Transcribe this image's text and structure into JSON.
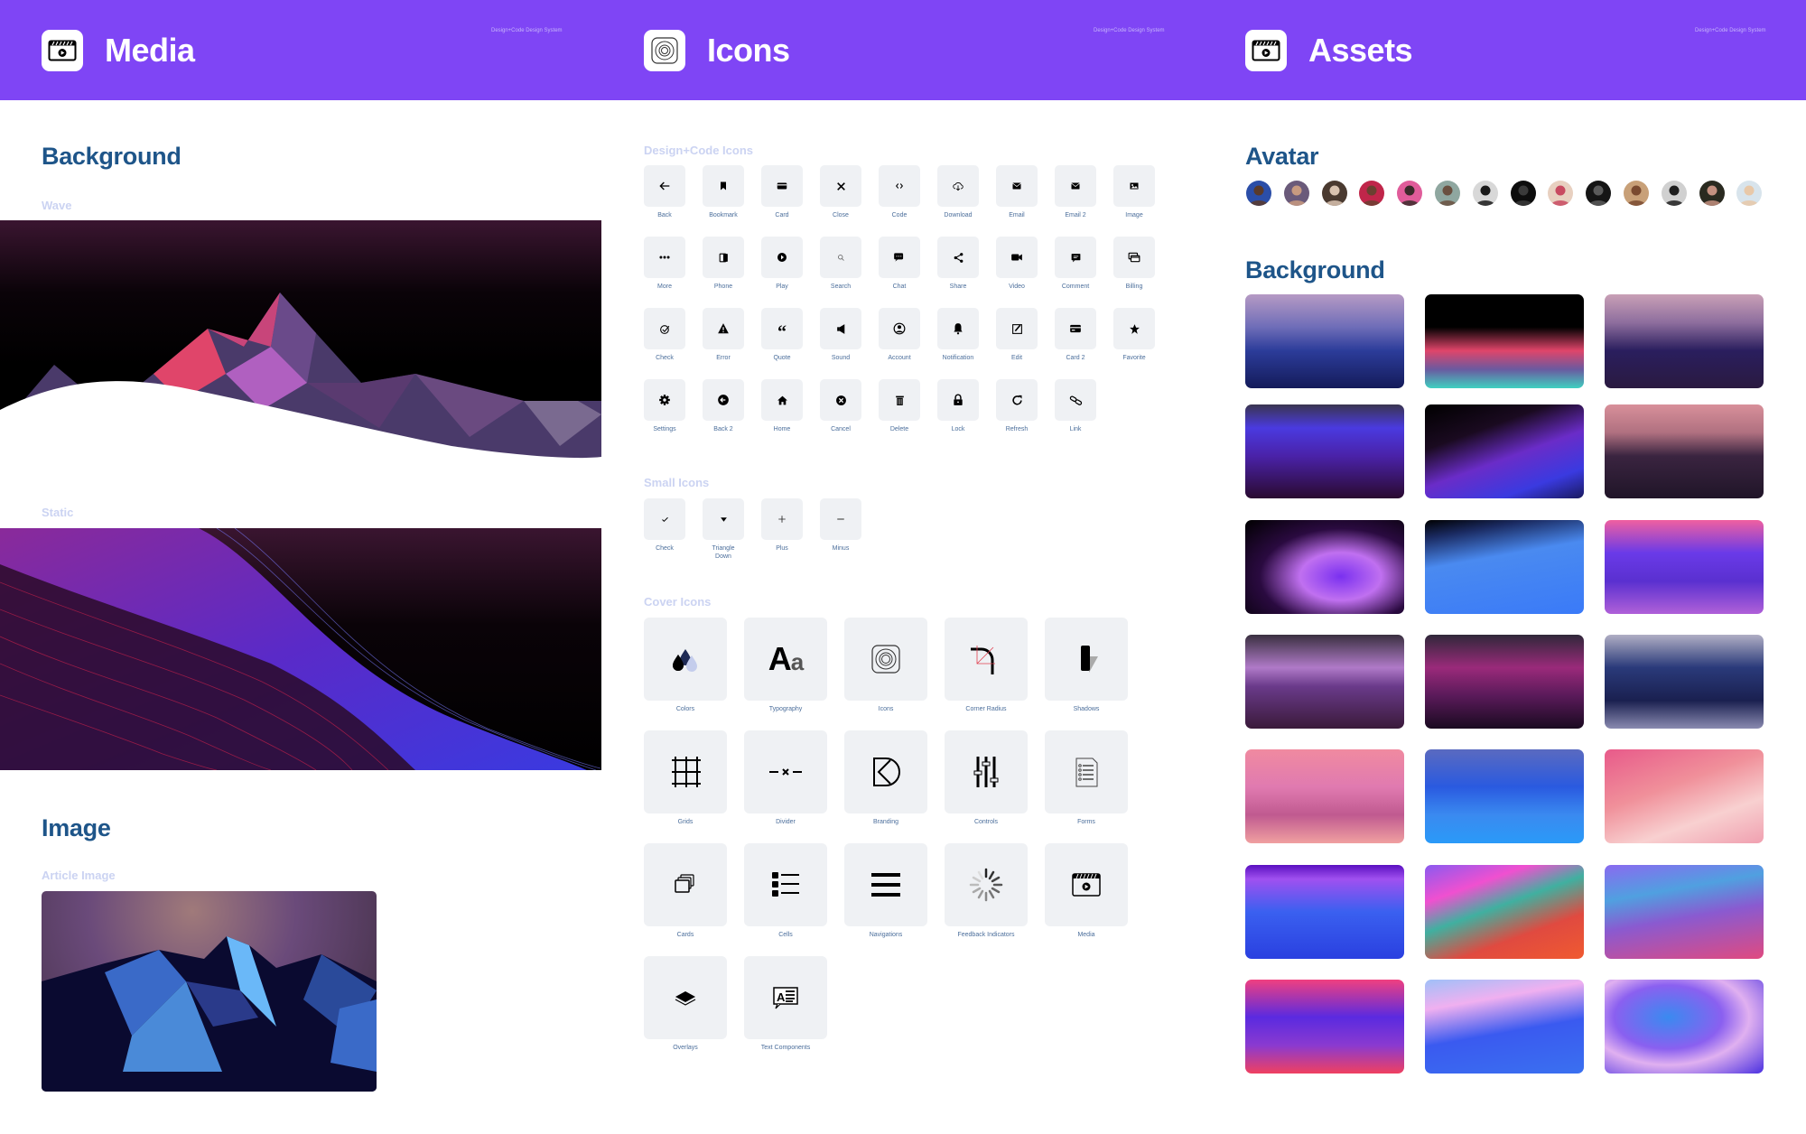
{
  "header": {
    "tag": "Design+Code Design System",
    "panels": [
      {
        "title": "Media",
        "icon": "clapperboard-icon"
      },
      {
        "title": "Icons",
        "icon": "icons-app-icon"
      },
      {
        "title": "Assets",
        "icon": "clapperboard-icon"
      }
    ]
  },
  "media": {
    "background_heading": "Background",
    "wave_label": "Wave",
    "static_label": "Static",
    "image_heading": "Image",
    "article_label": "Article Image"
  },
  "icons": {
    "dc_heading": "Design+Code Icons",
    "dc_icons": [
      {
        "label": "Back",
        "glyph": "←"
      },
      {
        "label": "Bookmark",
        "glyph": "bookmark"
      },
      {
        "label": "Card",
        "glyph": "card"
      },
      {
        "label": "Close",
        "glyph": "✕"
      },
      {
        "label": "Code",
        "glyph": "‹›"
      },
      {
        "label": "Download",
        "glyph": "cloud"
      },
      {
        "label": "Email",
        "glyph": "✉"
      },
      {
        "label": "Email 2",
        "glyph": "✉"
      },
      {
        "label": "Image",
        "glyph": "image"
      },
      {
        "label": "More",
        "glyph": "•••"
      },
      {
        "label": "Phone",
        "glyph": "phone"
      },
      {
        "label": "Play",
        "glyph": "play"
      },
      {
        "label": "Search",
        "glyph": "search"
      },
      {
        "label": "Chat",
        "glyph": "chat"
      },
      {
        "label": "Share",
        "glyph": "share"
      },
      {
        "label": "Video",
        "glyph": "video"
      },
      {
        "label": "Comment",
        "glyph": "comment"
      },
      {
        "label": "Billing",
        "glyph": "billing"
      },
      {
        "label": "Check",
        "glyph": "check-circle"
      },
      {
        "label": "Error",
        "glyph": "warning"
      },
      {
        "label": "Quote",
        "glyph": "“"
      },
      {
        "label": "Sound",
        "glyph": "sound"
      },
      {
        "label": "Account",
        "glyph": "account"
      },
      {
        "label": "Notification",
        "glyph": "bell"
      },
      {
        "label": "Edit",
        "glyph": "edit"
      },
      {
        "label": "Card 2",
        "glyph": "card2"
      },
      {
        "label": "Favorite",
        "glyph": "★"
      },
      {
        "label": "Settings",
        "glyph": "gear"
      },
      {
        "label": "Back 2",
        "glyph": "back-circle"
      },
      {
        "label": "Home",
        "glyph": "home"
      },
      {
        "label": "Cancel",
        "glyph": "cancel-circle"
      },
      {
        "label": "Delete",
        "glyph": "trash"
      },
      {
        "label": "Lock",
        "glyph": "lock"
      },
      {
        "label": "Refresh",
        "glyph": "refresh"
      },
      {
        "label": "Link",
        "glyph": "link"
      }
    ],
    "small_heading": "Small Icons",
    "small_icons": [
      {
        "label": "Check",
        "glyph": "✓"
      },
      {
        "label": "Triangle Down",
        "glyph": "▼"
      },
      {
        "label": "Plus",
        "glyph": "+"
      },
      {
        "label": "Minus",
        "glyph": "−"
      }
    ],
    "cover_heading": "Cover Icons",
    "cover_icons": [
      {
        "label": "Colors",
        "glyph": "drops"
      },
      {
        "label": "Typography",
        "glyph": "Aa"
      },
      {
        "label": "Icons",
        "glyph": "icons"
      },
      {
        "label": "Corner Radius",
        "glyph": "corner"
      },
      {
        "label": "Shadows",
        "glyph": "shadow"
      },
      {
        "label": "Grids",
        "glyph": "grid"
      },
      {
        "label": "Divider",
        "glyph": "divider"
      },
      {
        "label": "Branding",
        "glyph": "branding"
      },
      {
        "label": "Controls",
        "glyph": "sliders"
      },
      {
        "label": "Forms",
        "glyph": "form"
      },
      {
        "label": "Cards",
        "glyph": "cards"
      },
      {
        "label": "Cells",
        "glyph": "cells"
      },
      {
        "label": "Navigations",
        "glyph": "menu"
      },
      {
        "label": "Feedback Indicators",
        "glyph": "spinner"
      },
      {
        "label": "Media",
        "glyph": "clapper"
      },
      {
        "label": "Overlays",
        "glyph": "layers"
      },
      {
        "label": "Text Components",
        "glyph": "text"
      }
    ]
  },
  "assets": {
    "avatar_heading": "Avatar",
    "avatars": [
      {
        "bg": "#2B4EA8",
        "face": "#5A3A2A"
      },
      {
        "bg": "#6A5A7A",
        "face": "#C89A80"
      },
      {
        "bg": "#4A3A30",
        "face": "#D9C3B0"
      },
      {
        "bg": "#C0264A",
        "face": "#6A4030"
      },
      {
        "bg": "#E05C9A",
        "face": "#3A2A2A"
      },
      {
        "bg": "#8FA7A0",
        "face": "#6A5040"
      },
      {
        "bg": "#D8D8D8",
        "face": "#1A1A1A"
      },
      {
        "bg": "#0D0D0D",
        "face": "#3A3A3A"
      },
      {
        "bg": "#E8D0C0",
        "face": "#C84A60"
      },
      {
        "bg": "#151515",
        "face": "#5A5A5A"
      },
      {
        "bg": "#C8A078",
        "face": "#7A4A30"
      },
      {
        "bg": "#D0D0D0",
        "face": "#1E1E1E"
      },
      {
        "bg": "#2A2A20",
        "face": "#C49080"
      },
      {
        "bg": "#D8E4EC",
        "face": "#E8C8A8"
      }
    ],
    "background_heading": "Background",
    "thumbnails": [
      {
        "name": "lowpoly-blue-dusk",
        "bg": "linear-gradient(180deg,#B69AC4 0%,#6E6DB8 35%,#2C3C9A 60%,#141B5A 100%)"
      },
      {
        "name": "lowpoly-neon-dark",
        "bg": "linear-gradient(180deg,#000 0%,#000 35%,#E0456A 60%,#6A5AA0 80%,#3FD0C0 100%)"
      },
      {
        "name": "lowpoly-purple-pink",
        "bg": "linear-gradient(180deg,#C9A0B6 0%,#8E6E9E 30%,#2A1E5E 60%,#2A1A40 100%)"
      },
      {
        "name": "wave-blue-purple",
        "bg": "linear-gradient(180deg,#3A3550 0%,#4A3AE0 25%,#4A22A8 55%,#2A0A30 100%)"
      },
      {
        "name": "wave-dark-blue",
        "bg": "linear-gradient(160deg,#000 0%,#1A0A20 30%,#6A2CC8 55%,#3A3AE0 80%,#1A1A60 100%)"
      },
      {
        "name": "lowpoly-peach-dark",
        "bg": "linear-gradient(180deg,#D8909A 0%,#B07080 30%,#3A2440 55%,#201528 100%)"
      },
      {
        "name": "blob-violet",
        "bg": "radial-gradient(ellipse at 60% 60%,#7A30F0 0%,#C070F0 30%,#2A0A40 60%,#000 100%)"
      },
      {
        "name": "wave-sky-blue",
        "bg": "linear-gradient(170deg,#000 0%,#1A2A60 15%,#4A8AF0 40%,#3A7AF8 100%)"
      },
      {
        "name": "wave-purple-pink",
        "bg": "linear-gradient(180deg,#F060A0 0%,#6A3AE8 35%,#5A30D0 65%,#B060D8 100%)"
      },
      {
        "name": "dunes-dusk",
        "bg": "linear-gradient(180deg,#3A3040 0%,#B07AC8 35%,#6A3A8A 55%,#3A1A3A 100%)"
      },
      {
        "name": "hills-magenta",
        "bg": "linear-gradient(180deg,#30283A 0%,#9A2A7A 35%,#5A1A5A 65%,#1A0A20 100%)"
      },
      {
        "name": "lowpoly-navy",
        "bg": "linear-gradient(180deg,#B0AEC4 0%,#2A3A7A 35%,#1A2050 70%,#8A8AB0 100%)"
      },
      {
        "name": "lowpoly-pink",
        "bg": "linear-gradient(180deg,#F08AA0 0%,#E07AB0 40%,#C05A90 70%,#F0A0A0 100%)"
      },
      {
        "name": "lowpoly-bright-blue",
        "bg": "linear-gradient(180deg,#5A6AC0 0%,#2A5AE0 40%,#3A8AF0 70%,#2A9AF8 100%)"
      },
      {
        "name": "desert-pink-rocks",
        "bg": "linear-gradient(160deg,#E85A8A 0%,#F0909A 40%,#F8D0D0 70%,#F0A0B0 100%)"
      },
      {
        "name": "terrain-blue-violet",
        "bg": "linear-gradient(180deg,#5A10C0 0%,#A050F0 15%,#3A60F0 50%,#2A40E0 100%)"
      },
      {
        "name": "wave-red-teal",
        "bg": "linear-gradient(160deg,#8A5AF0 0%,#F050D0 25%,#40B0A0 45%,#E04A40 70%,#F05A30 100%)"
      },
      {
        "name": "wave-teal-pink",
        "bg": "linear-gradient(170deg,#8A6AF0 0%,#50A0E0 30%,#8A5AD0 55%,#E04A80 100%)"
      },
      {
        "name": "wave-pink-violet",
        "bg": "linear-gradient(180deg,#F04080 0%,#5A2AE0 40%,#8A3AD0 70%,#F04060 100%)"
      },
      {
        "name": "terrain-blue-glow",
        "bg": "linear-gradient(170deg,#A0C0F8 0%,#F0B0F0 25%,#3A5AF0 55%,#3A70F0 100%)"
      },
      {
        "name": "blur-violet",
        "bg": "radial-gradient(ellipse at 40% 40%,#3A8AF0 0%,#8A60F0 40%,#E0B0F0 60%,#4A30E0 100%)"
      }
    ]
  }
}
